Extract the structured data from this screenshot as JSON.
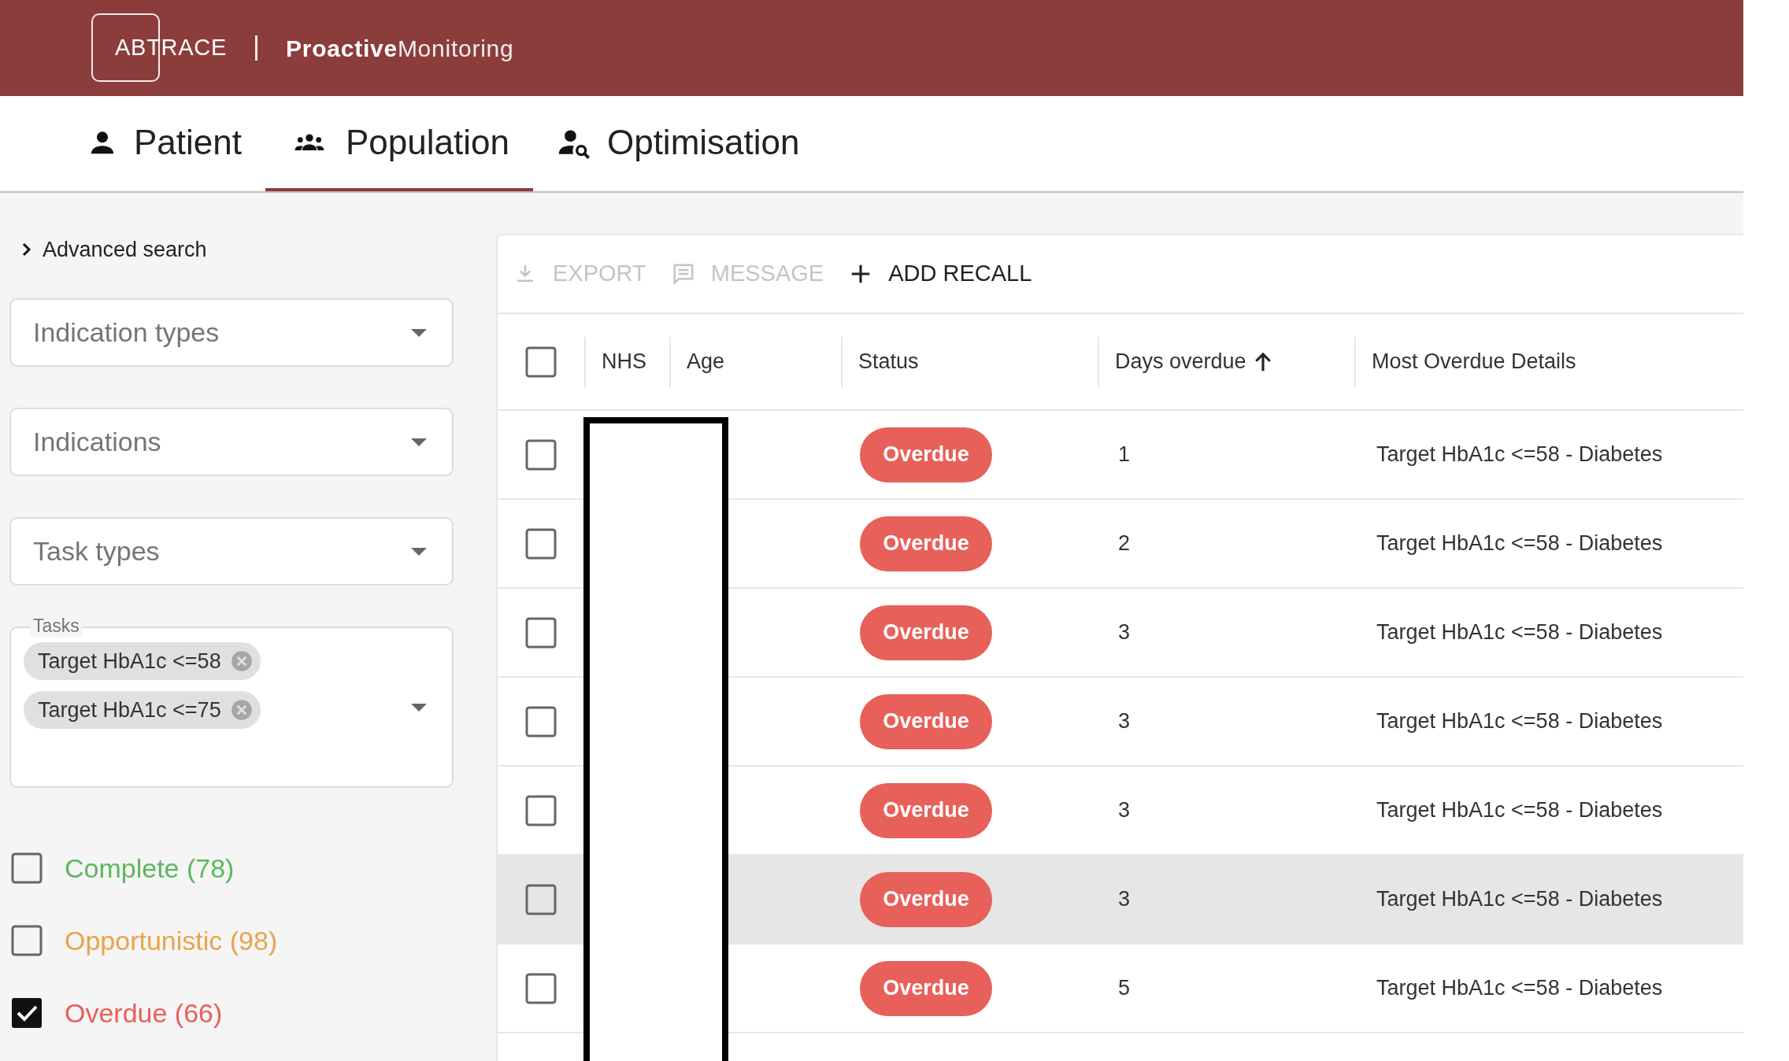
{
  "header": {
    "logo": "ABTRACE",
    "product_bold": "Proactive",
    "product_light": "Monitoring"
  },
  "tabs": [
    {
      "label": "Patient",
      "selected": false
    },
    {
      "label": "Population",
      "selected": true
    },
    {
      "label": "Optimisation",
      "selected": false
    }
  ],
  "sidebar": {
    "advanced_search": "Advanced search",
    "dropdowns": [
      {
        "placeholder": "Indication types"
      },
      {
        "placeholder": "Indications"
      },
      {
        "placeholder": "Task types"
      }
    ],
    "tasks": {
      "label": "Tasks",
      "chips": [
        "Target HbA1c <=58",
        "Target HbA1c <=75"
      ]
    },
    "filters": [
      {
        "label": "Complete (78)",
        "color": "#5cb85c",
        "checked": false
      },
      {
        "label": "Opportunistic (98)",
        "color": "#e8a54b",
        "checked": false
      },
      {
        "label": "Overdue (66)",
        "color": "#e8605a",
        "checked": true
      }
    ]
  },
  "toolbar": [
    {
      "label": "EXPORT",
      "disabled": true
    },
    {
      "label": "MESSAGE",
      "disabled": true
    },
    {
      "label": "ADD RECALL",
      "disabled": false
    }
  ],
  "table": {
    "select_all_checked": false,
    "columns": [
      "NHS",
      "Age",
      "Status",
      "Days overdue",
      "Most Overdue Details"
    ],
    "rows": [
      {
        "status": "Overdue",
        "days_overdue": "1",
        "details": "Target HbA1c <=58 - Diabetes",
        "checked": false,
        "highlighted": false
      },
      {
        "status": "Overdue",
        "days_overdue": "2",
        "details": "Target HbA1c <=58 - Diabetes",
        "checked": false,
        "highlighted": false
      },
      {
        "status": "Overdue",
        "days_overdue": "3",
        "details": "Target HbA1c <=58 - Diabetes",
        "checked": false,
        "highlighted": false
      },
      {
        "status": "Overdue",
        "days_overdue": "3",
        "details": "Target HbA1c <=58 - Diabetes",
        "checked": false,
        "highlighted": false
      },
      {
        "status": "Overdue",
        "days_overdue": "3",
        "details": "Target HbA1c <=58 - Diabetes",
        "checked": false,
        "highlighted": false
      },
      {
        "status": "Overdue",
        "days_overdue": "3",
        "details": "Target HbA1c <=58 - Diabetes",
        "checked": false,
        "highlighted": true
      },
      {
        "status": "Overdue",
        "days_overdue": "5",
        "details": "Target HbA1c <=58 - Diabetes",
        "checked": false,
        "highlighted": false
      }
    ]
  }
}
